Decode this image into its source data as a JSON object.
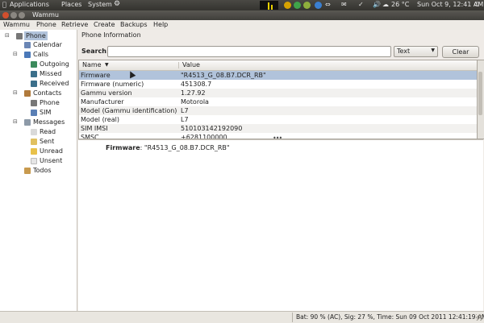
{
  "top_panel": {
    "menus": [
      "Applications",
      "Places",
      "System"
    ],
    "weather": "26 °C",
    "clock": "Sun Oct  9, 12:41 AM"
  },
  "window": {
    "title": "Wammu"
  },
  "menubar": [
    "Wammu",
    "Phone",
    "Retrieve",
    "Create",
    "Backups",
    "Help"
  ],
  "tree": {
    "phone": "Phone",
    "calendar": "Calendar",
    "calls": "Calls",
    "calls_children": [
      "Outgoing",
      "Missed",
      "Received"
    ],
    "contacts": "Contacts",
    "contacts_children": [
      "Phone",
      "SIM"
    ],
    "messages": "Messages",
    "messages_children": [
      "Read",
      "Sent",
      "Unread",
      "Unsent"
    ],
    "todos": "Todos"
  },
  "section_title": "Phone Information",
  "search": {
    "label": "Search:",
    "value": "",
    "type": "Text",
    "clear": "Clear"
  },
  "table": {
    "columns": [
      "Name",
      "Value"
    ],
    "rows": [
      {
        "name": "Firmware",
        "value": "\"R4513_G_08.B7.DCR_RB\""
      },
      {
        "name": "Firmware (numeric)",
        "value": "451308.7"
      },
      {
        "name": "Gammu version",
        "value": "1.27.92"
      },
      {
        "name": "Manufacturer",
        "value": "Motorola"
      },
      {
        "name": "Model (Gammu identification)",
        "value": "L7"
      },
      {
        "name": "Model (real)",
        "value": "L7"
      },
      {
        "name": "SIM IMSI",
        "value": "510103142192090"
      },
      {
        "name": "SMSC",
        "value": "+6281100000"
      }
    ]
  },
  "details": {
    "label": "Firmware",
    "value": "\"R4513_G_08.B7.DCR_RB\""
  },
  "statusbar": {
    "text": "Bat: 90 % (AC), Sig: 27 %, Time: Sun 09 Oct 2011 12:41:19 AM"
  },
  "colors": {
    "selection": "#b1c3db",
    "panel": "#3f3e3a",
    "window_bg": "#efebe7"
  }
}
